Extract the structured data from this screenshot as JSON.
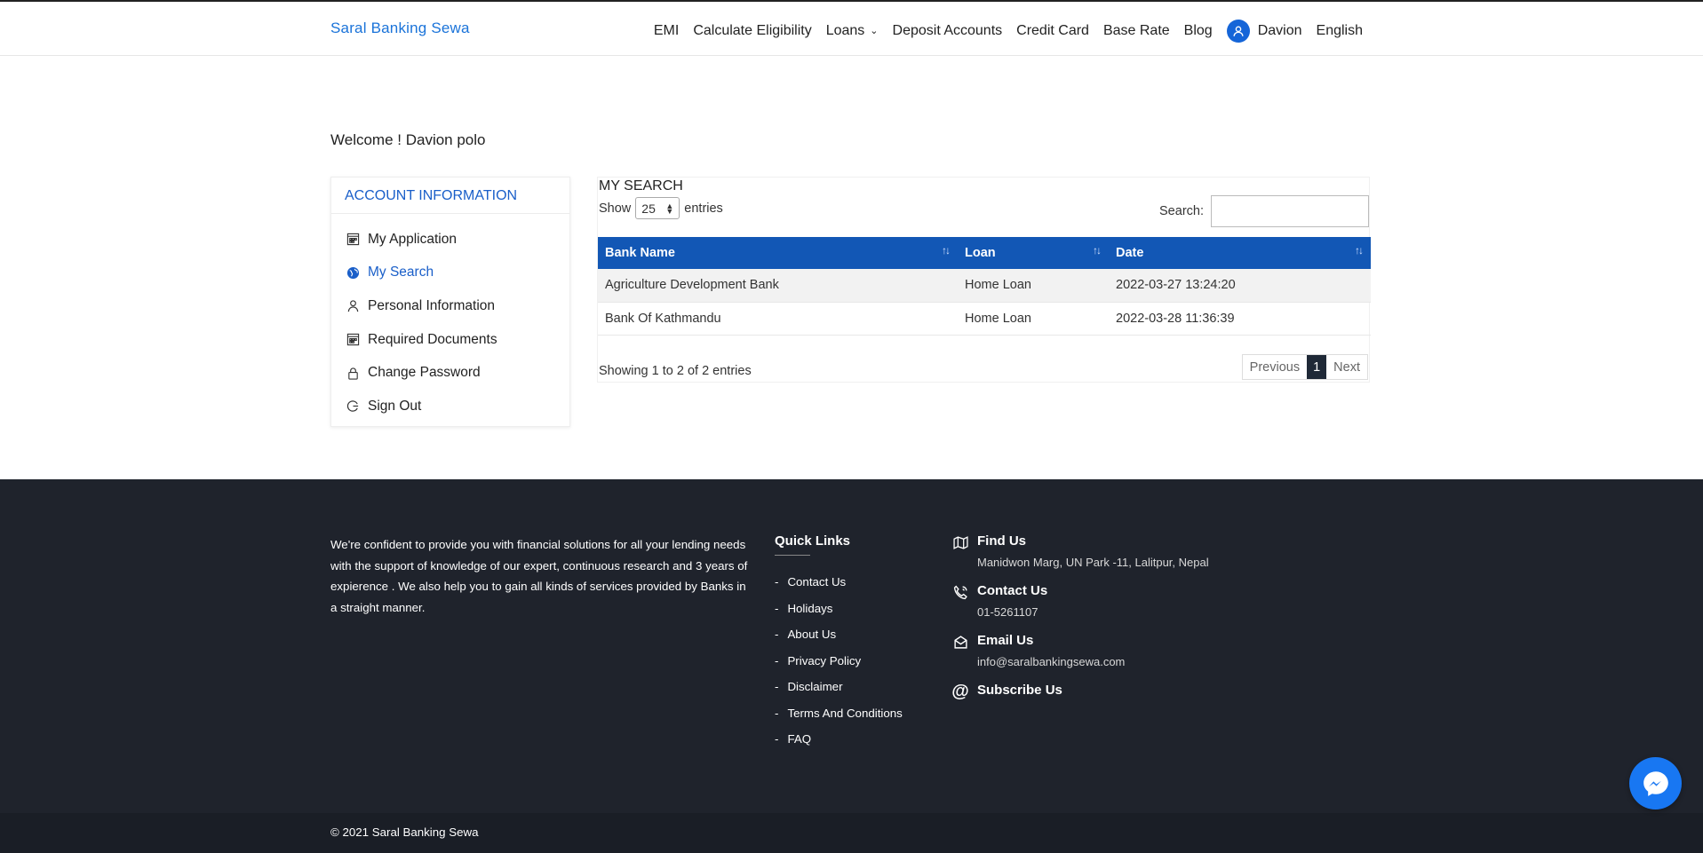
{
  "header": {
    "brand": "Saral Banking Sewa",
    "nav": [
      "EMI",
      "Calculate Eligibility",
      "Loans",
      "Deposit Accounts",
      "Credit Card",
      "Base Rate",
      "Blog"
    ],
    "user_name": "Davion",
    "language": "English"
  },
  "welcome": "Welcome ! Davion polo",
  "sidebar": {
    "title": "ACCOUNT INFORMATION",
    "items": [
      {
        "label": "My Application",
        "icon": "calendar-icon"
      },
      {
        "label": "My Search",
        "icon": "globe-icon"
      },
      {
        "label": "Personal Information",
        "icon": "user-icon"
      },
      {
        "label": "Required Documents",
        "icon": "calendar-icon"
      },
      {
        "label": "Change Password",
        "icon": "lock-icon"
      },
      {
        "label": "Sign Out",
        "icon": "signout-icon"
      }
    ],
    "active_index": 1
  },
  "search_panel": {
    "title": "MY SEARCH",
    "show_label": "Show",
    "entries_value": "25",
    "entries_label": "entries",
    "search_label": "Search:",
    "search_value": "",
    "columns": [
      "Bank Name",
      "Loan",
      "Date"
    ],
    "rows": [
      [
        "Agriculture Development Bank",
        "Home Loan",
        "2022-03-27 13:24:20"
      ],
      [
        "Bank Of Kathmandu",
        "Home Loan",
        "2022-03-28 11:36:39"
      ]
    ],
    "showing": "Showing 1 to 2 of 2 entries",
    "pager": {
      "previous": "Previous",
      "current": "1",
      "next": "Next"
    }
  },
  "footer": {
    "about": "We're confident to provide you with financial solutions for all your lending needs with the support of knowledge of our expert, continuous research and 3 years of expierence . We also help you to gain all kinds of services provided by Banks in a straight manner.",
    "quick_links_title": "Quick Links",
    "quick_links": [
      "Contact Us",
      "Holidays",
      "About Us",
      "Privacy Policy",
      "Disclaimer",
      "Terms And Conditions",
      "FAQ"
    ],
    "find_us_title": "Find Us",
    "find_us_text": "Manidwon Marg, UN Park -11, Lalitpur, Nepal",
    "contact_title": "Contact Us",
    "contact_text": "01-5261107",
    "email_title": "Email Us",
    "email_text": "info@saralbankingsewa.com",
    "subscribe_title": "Subscribe Us",
    "copyright": "© 2021 Saral Banking Sewa"
  },
  "colors": {
    "brand_blue": "#1a73d9",
    "table_header": "#1257b5",
    "footer_bg": "#1f232c",
    "messenger": "#1877f2"
  }
}
